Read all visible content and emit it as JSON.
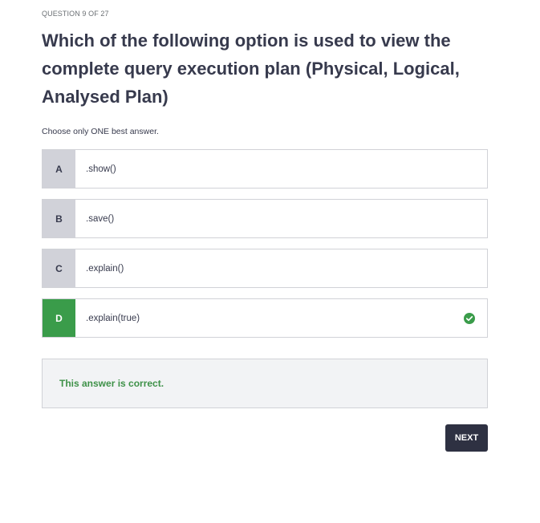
{
  "quiz": {
    "counter": "QUESTION 9 OF 27",
    "question": "Which of the following option is used to view the complete query execution plan (Physical, Logical, Analysed Plan)",
    "instruction": "Choose only ONE best answer.",
    "options": [
      {
        "letter": "A",
        "text": ".show()"
      },
      {
        "letter": "B",
        "text": ".save()"
      },
      {
        "letter": "C",
        "text": ".explain()"
      },
      {
        "letter": "D",
        "text": ".explain(true)"
      }
    ],
    "selected": "D",
    "feedback": "This answer is correct.",
    "next_label": "NEXT"
  },
  "colors": {
    "correct": "#3a9c4a",
    "letter_bg": "#d1d2d9",
    "next_bg": "#2e3142",
    "feedback_bg": "#f2f3f5"
  },
  "icons": {
    "selected_indicator": "check-circle-icon"
  }
}
